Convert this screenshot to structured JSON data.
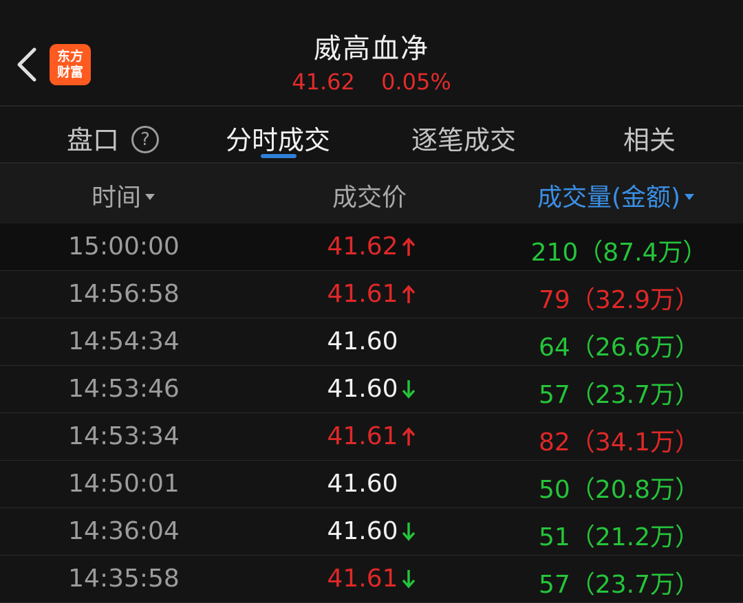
{
  "header": {
    "title": "威高血净",
    "price": "41.62",
    "change": "0.05%",
    "logo_line1": "东方",
    "logo_line2": "财富"
  },
  "tabs": [
    {
      "label": "盘口"
    },
    {
      "label": "分时成交",
      "active": true
    },
    {
      "label": "逐笔成交"
    },
    {
      "label": "相关"
    }
  ],
  "columns": {
    "time": "时间",
    "price": "成交价",
    "volume": "成交量(金额)"
  },
  "rows": [
    {
      "time": "15:00:00",
      "price": "41.62",
      "price_color": "red",
      "arrow": "up",
      "volume": "210（87.4万）",
      "vol_color": "green"
    },
    {
      "time": "14:56:58",
      "price": "41.61",
      "price_color": "red",
      "arrow": "up",
      "volume": "79（32.9万）",
      "vol_color": "red"
    },
    {
      "time": "14:54:34",
      "price": "41.60",
      "price_color": "white",
      "arrow": "none",
      "volume": "64（26.6万）",
      "vol_color": "green"
    },
    {
      "time": "14:53:46",
      "price": "41.60",
      "price_color": "white",
      "arrow": "down",
      "volume": "57（23.7万）",
      "vol_color": "green"
    },
    {
      "time": "14:53:34",
      "price": "41.61",
      "price_color": "red",
      "arrow": "up",
      "volume": "82（34.1万）",
      "vol_color": "red"
    },
    {
      "time": "14:50:01",
      "price": "41.60",
      "price_color": "white",
      "arrow": "none",
      "volume": "50（20.8万）",
      "vol_color": "green"
    },
    {
      "time": "14:36:04",
      "price": "41.60",
      "price_color": "white",
      "arrow": "down",
      "volume": "51（21.2万）",
      "vol_color": "green"
    },
    {
      "time": "14:35:58",
      "price": "41.61",
      "price_color": "red",
      "arrow": "down",
      "volume": "57（23.7万）",
      "vol_color": "green"
    }
  ],
  "colors": {
    "up": "#e02828",
    "down": "#25c43a",
    "accent": "#2f80d8",
    "logo": "#ff5a1f"
  }
}
